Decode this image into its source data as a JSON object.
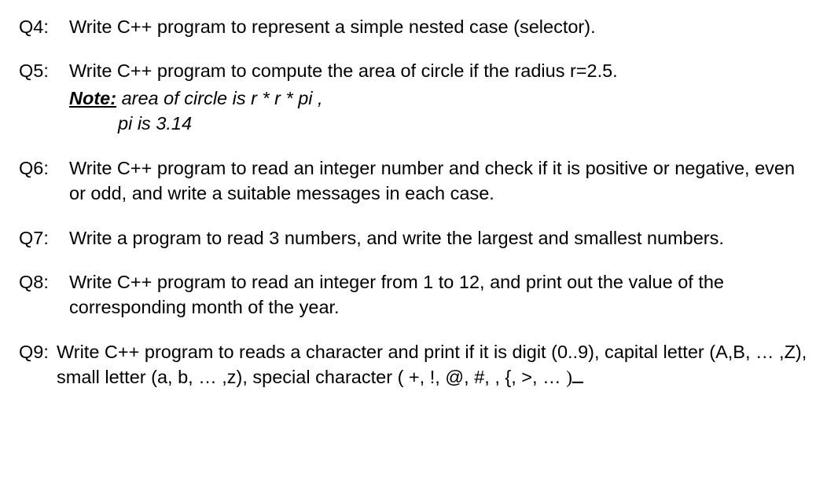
{
  "questions": {
    "q4": {
      "label": "Q4:",
      "text": "Write C++ program to represent a simple nested case (selector)."
    },
    "q5": {
      "label": "Q5:",
      "text": "Write C++ program to compute the area of circle if the radius r=2.5.",
      "note_label": "Note:",
      "note_text": " area of circle is r * r * pi ,",
      "pi_text": "pi is 3.14"
    },
    "q6": {
      "label": "Q6:",
      "text": "Write C++ program to read an integer number and check if it is positive or negative, even or odd, and write a suitable messages in each case."
    },
    "q7": {
      "label": "Q7:",
      "text": "Write a program to read 3 numbers, and write the largest and smallest numbers."
    },
    "q8": {
      "label": "Q8:",
      "text": "Write C++ program to read an integer from 1 to 12, and print out the value of the corresponding month of the year."
    },
    "q9": {
      "label": "Q9:",
      "text_part1": "Write C++ program to reads a character and print if it is digit (0..9), capital letter (A,B, … ,Z), small letter (a, b, … ,z), special character ( +, !, @, #, , {, >, … ",
      "text_part2": ")ــ"
    }
  }
}
